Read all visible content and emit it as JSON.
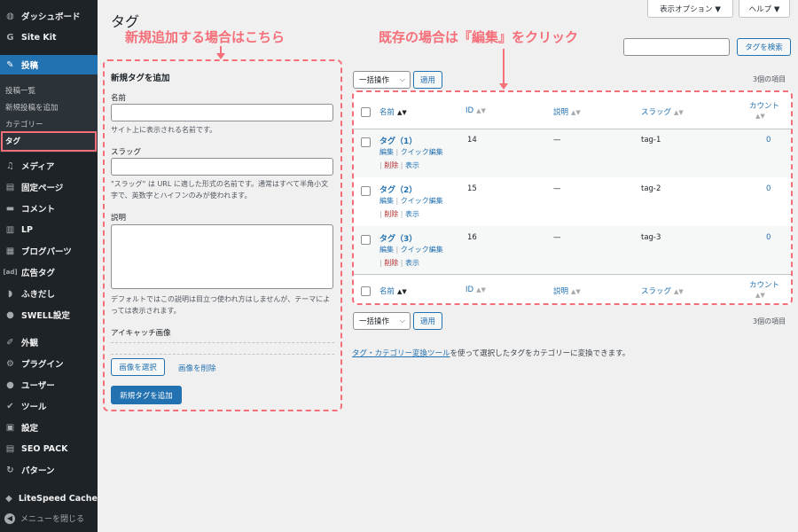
{
  "sidebar": {
    "top_items": [
      {
        "label": "ダッシュボード",
        "icon": "dashboard-icon",
        "glyph": "◍"
      },
      {
        "label": "Site Kit",
        "icon": "site-kit-icon",
        "glyph": "G"
      }
    ],
    "posts_label": "投稿",
    "posts_glyph": "✎",
    "submenu": [
      "投稿一覧",
      "新規投稿を追加",
      "カテゴリー",
      "タグ"
    ],
    "items": [
      {
        "label": "メディア",
        "icon": "media-icon",
        "glyph": "♫"
      },
      {
        "label": "固定ページ",
        "icon": "pages-icon",
        "glyph": "▤"
      },
      {
        "label": "コメント",
        "icon": "comments-icon",
        "glyph": "▬"
      },
      {
        "label": "LP",
        "icon": "lp-icon",
        "glyph": "▥"
      },
      {
        "label": "ブログパーツ",
        "icon": "blog-parts-icon",
        "glyph": "▦"
      },
      {
        "label": "広告タグ",
        "icon": "ad-tag-icon",
        "glyph": "[ad]"
      },
      {
        "label": "ふきだし",
        "icon": "balloon-icon",
        "glyph": "◗"
      },
      {
        "label": "SWELL設定",
        "icon": "swell-icon",
        "glyph": "●"
      },
      {
        "label": "外観",
        "icon": "appearance-icon",
        "glyph": "✐"
      },
      {
        "label": "プラグイン",
        "icon": "plugins-icon",
        "glyph": "⚙"
      },
      {
        "label": "ユーザー",
        "icon": "users-icon",
        "glyph": "●"
      },
      {
        "label": "ツール",
        "icon": "tools-icon",
        "glyph": "✔"
      },
      {
        "label": "設定",
        "icon": "settings-icon",
        "glyph": "▣"
      },
      {
        "label": "SEO PACK",
        "icon": "seo-pack-icon",
        "glyph": "▤"
      },
      {
        "label": "パターン",
        "icon": "patterns-icon",
        "glyph": "↻"
      },
      {
        "label": "LiteSpeed Cache",
        "icon": "litespeed-icon",
        "glyph": "◆"
      }
    ],
    "collapse_label": "メニューを閉じる"
  },
  "header": {
    "title": "タグ",
    "screen_options": "表示オプション ▼",
    "help": "ヘルプ ▼"
  },
  "annotations": {
    "left": "新規追加する場合はこちら",
    "right": "既存の場合は『編集』をクリック"
  },
  "form": {
    "heading": "新規タグを追加",
    "name_label": "名前",
    "name_help": "サイト上に表示される名前です。",
    "slug_label": "スラッグ",
    "slug_help": "\"スラッグ\" は URL に適した形式の名前です。通常はすべて半角小文字で、英数字とハイフンのみが使われます。",
    "desc_label": "説明",
    "desc_help": "デフォルトではこの説明は目立つ使われ方はしませんが、テーマによっては表示されます。",
    "eyecatch_label": "アイキャッチ画像",
    "select_image": "画像を選択",
    "remove_image": "画像を削除",
    "submit": "新規タグを追加"
  },
  "search": {
    "button": "タグを検索"
  },
  "bulk": {
    "select": "一括操作",
    "apply": "適用",
    "count": "3個の項目"
  },
  "table": {
    "headers": {
      "name": "名前",
      "id": "ID",
      "desc": "説明",
      "slug": "スラッグ",
      "count": "カウント"
    },
    "rows": [
      {
        "name": "タグ（1）",
        "id": "14",
        "desc": "—",
        "slug": "tag-1",
        "count": "0"
      },
      {
        "name": "タグ（2）",
        "id": "15",
        "desc": "—",
        "slug": "tag-2",
        "count": "0"
      },
      {
        "name": "タグ（3）",
        "id": "16",
        "desc": "—",
        "slug": "tag-3",
        "count": "0"
      }
    ],
    "actions": {
      "edit": "編集",
      "quick": "クイック編集",
      "delete": "削除",
      "view": "表示"
    }
  },
  "footer": {
    "link": "タグ・カテゴリー変換ツール",
    "text": "を使って選択したタグをカテゴリーに変換できます。"
  },
  "colors": {
    "accent": "#2271b1",
    "annotation": "#f56f79",
    "sidebar": "#1d2327"
  }
}
